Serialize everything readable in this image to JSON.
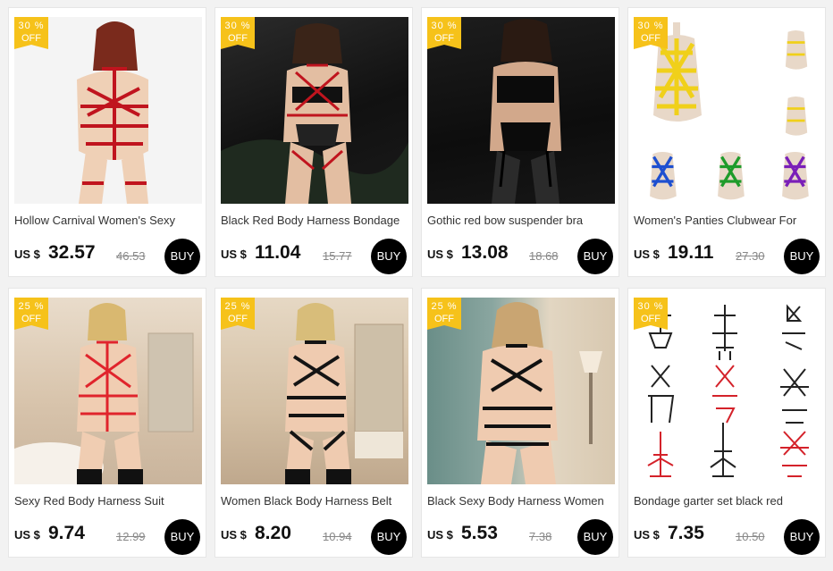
{
  "products": [
    {
      "discount_value": "30",
      "discount_unit": "%",
      "discount_label": "OFF",
      "title": "Hollow Carnival Women's Sexy",
      "currency": "US $",
      "price": "32.57",
      "old_price": "46.53",
      "buy_label": "BUY",
      "image_icon": "red-harness-bodysuit-image"
    },
    {
      "discount_value": "30",
      "discount_unit": "%",
      "discount_label": "OFF",
      "title": "Black Red Body Harness Bondage",
      "currency": "US $",
      "price": "11.04",
      "old_price": "15.77",
      "buy_label": "BUY",
      "image_icon": "harness-outdoor-night-image"
    },
    {
      "discount_value": "30",
      "discount_unit": "%",
      "discount_label": "OFF",
      "title": "Gothic red bow suspender bra",
      "currency": "US $",
      "price": "13.08",
      "old_price": "18.68",
      "buy_label": "BUY",
      "image_icon": "black-suspender-set-image"
    },
    {
      "discount_value": "30",
      "discount_unit": "%",
      "discount_label": "OFF",
      "title": "Women's Panties Clubwear For",
      "currency": "US $",
      "price": "19.11",
      "old_price": "27.30",
      "buy_label": "BUY",
      "image_icon": "mannequin-color-variants-image"
    },
    {
      "discount_value": "25",
      "discount_unit": "%",
      "discount_label": "OFF",
      "title": "Sexy Red Body Harness Suit",
      "currency": "US $",
      "price": "9.74",
      "old_price": "12.99",
      "buy_label": "BUY",
      "image_icon": "red-harness-bathroom-image"
    },
    {
      "discount_value": "25",
      "discount_unit": "%",
      "discount_label": "OFF",
      "title": "Women Black Body Harness Belt",
      "currency": "US $",
      "price": "8.20",
      "old_price": "10.94",
      "buy_label": "BUY",
      "image_icon": "black-harness-bathroom-image"
    },
    {
      "discount_value": "25",
      "discount_unit": "%",
      "discount_label": "OFF",
      "title": "Black Sexy Body Harness Women",
      "currency": "US $",
      "price": "5.53",
      "old_price": "7.38",
      "buy_label": "BUY",
      "image_icon": "black-harness-room-image"
    },
    {
      "discount_value": "30",
      "discount_unit": "%",
      "discount_label": "OFF",
      "title": "Bondage garter set black red",
      "currency": "US $",
      "price": "7.35",
      "old_price": "10.50",
      "buy_label": "BUY",
      "image_icon": "harness-line-variants-image"
    }
  ],
  "colors": {
    "badge": "#f6c21a",
    "buy_button": "#000000",
    "card_border": "#e6e6e6",
    "page_background": "#f2f2f2"
  }
}
